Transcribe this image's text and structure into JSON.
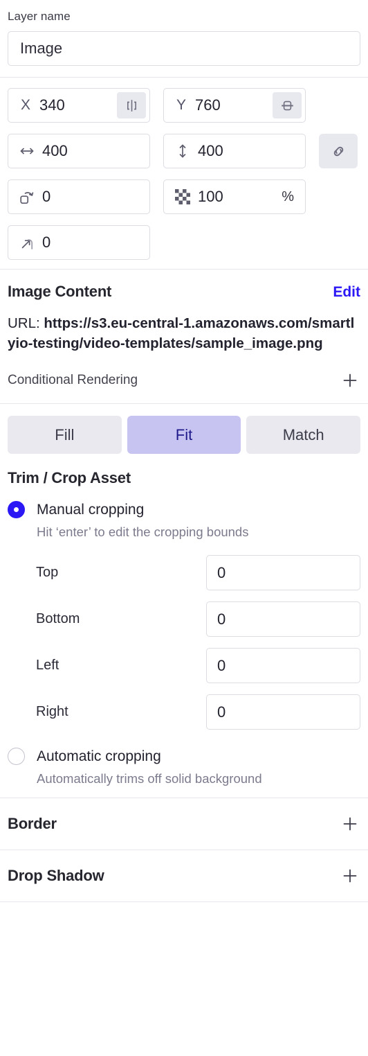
{
  "layer": {
    "name_label": "Layer name",
    "name_value": "Image",
    "name_placeholder": "Layer name"
  },
  "geometry": {
    "x": {
      "axis": "X",
      "value": "340",
      "icon": "align-horizontal-center-icon"
    },
    "y": {
      "axis": "Y",
      "value": "760",
      "icon": "align-vertical-center-icon"
    },
    "width": {
      "value": "400",
      "icon": "width-arrow-icon"
    },
    "height": {
      "value": "400",
      "icon": "height-arrow-icon"
    },
    "link_icon": "link-chain-icon",
    "rotation": {
      "value": "0",
      "icon": "rotate-icon"
    },
    "opacity": {
      "value": "100",
      "unit": "%",
      "icon": "opacity-checkerboard-icon"
    },
    "corner_radius": {
      "value": "0",
      "icon": "corner-radius-icon"
    }
  },
  "image_content": {
    "title": "Image Content",
    "edit_label": "Edit",
    "url_prefix": "URL: ",
    "url_value": "https://s3.eu-central-1.amazonaws.com/smartlyio-testing/video-templates/sample_image.png",
    "conditional_rendering_label": "Conditional Rendering",
    "add_icon": "plus-icon"
  },
  "fit_mode": {
    "options": [
      {
        "label": "Fill",
        "selected": false
      },
      {
        "label": "Fit",
        "selected": true
      },
      {
        "label": "Match",
        "selected": false
      }
    ]
  },
  "trim_crop": {
    "title": "Trim / Crop Asset",
    "manual": {
      "label": "Manual cropping",
      "help": "Hit ‘enter’ to edit the cropping bounds",
      "selected": true
    },
    "bounds": [
      {
        "label": "Top",
        "value": "0",
        "unit": "%"
      },
      {
        "label": "Bottom",
        "value": "0",
        "unit": "%"
      },
      {
        "label": "Left",
        "value": "0",
        "unit": "%"
      },
      {
        "label": "Right",
        "value": "0",
        "unit": "%"
      }
    ],
    "automatic": {
      "label": "Automatic cropping",
      "help": "Automatically trims off solid background",
      "selected": false
    }
  },
  "sections": [
    {
      "title": "Border",
      "add_icon": "plus-icon"
    },
    {
      "title": "Drop Shadow",
      "add_icon": "plus-icon"
    }
  ],
  "colors": {
    "accent_blue": "#2b18f5",
    "selected_seg_bg": "#c8c4f2",
    "selected_seg_text": "#1e1a8c",
    "seg_bg": "#e9e9ef",
    "border": "#dcdce3",
    "divider": "#e6e6ec",
    "text": "#23232f",
    "muted_text": "#7b7b8d"
  }
}
